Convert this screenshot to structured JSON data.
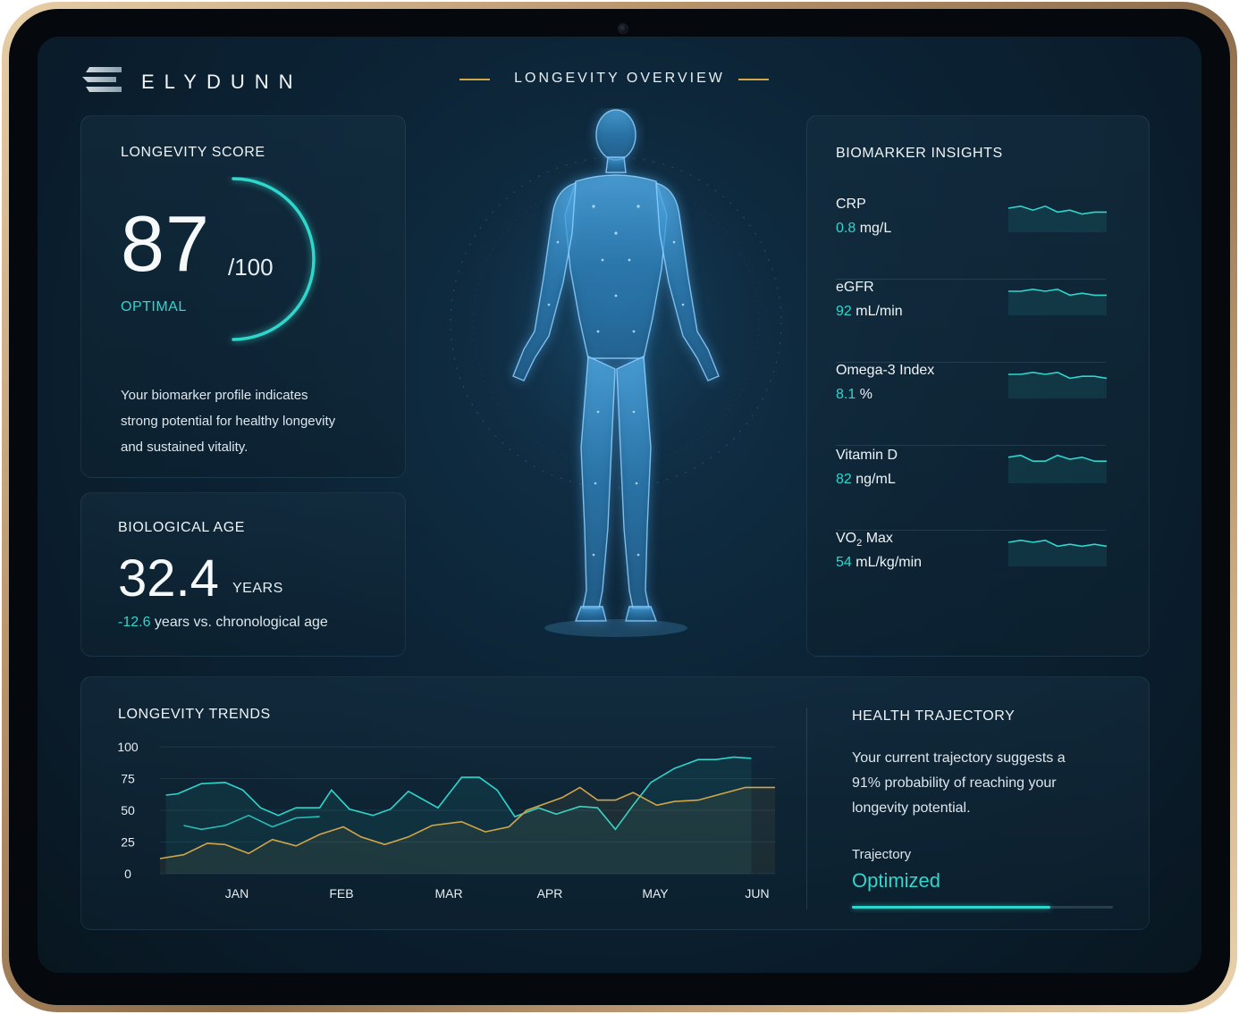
{
  "brand": {
    "name": "ELYDUNN",
    "icon": "stacked-bars-logo-icon"
  },
  "header": {
    "title": "LONGEVITY OVERVIEW"
  },
  "colors": {
    "accent": "#2fd6cc",
    "gold": "#d4a64a",
    "background": "#0c2436"
  },
  "score": {
    "label": "LONGEVITY SCORE",
    "value": "87",
    "max": "/100",
    "status": "OPTIMAL",
    "progress_fraction": 0.5,
    "description": "Your biomarker profile indicates strong potential for healthy longevity and sustained vitality."
  },
  "bio_age": {
    "label": "BIOLOGICAL AGE",
    "value": "32.4",
    "unit": "YEARS",
    "diff": "-12.6",
    "diff_text": " years vs. chronological age"
  },
  "biomarkers": {
    "title": "BIOMARKER INSIGHTS",
    "items": [
      {
        "name": "CRP",
        "name_sub": "",
        "name_suffix": "",
        "value": "0.8",
        "unit": " mg/L",
        "spark": [
          5,
          6,
          4,
          6,
          3,
          4,
          2,
          3,
          3
        ]
      },
      {
        "name": "eGFR",
        "name_sub": "",
        "name_suffix": "",
        "value": "92",
        "unit": " mL/min",
        "spark": [
          5,
          5,
          6,
          5,
          6,
          3,
          4,
          3,
          3
        ]
      },
      {
        "name": "Omega-3 Index",
        "name_sub": "",
        "name_suffix": "",
        "value": "8.1",
        "unit": " %",
        "spark": [
          5,
          5,
          6,
          5,
          6,
          3,
          4,
          4,
          3
        ]
      },
      {
        "name": "Vitamin D",
        "name_sub": "",
        "name_suffix": "",
        "value": "82",
        "unit": " ng/mL",
        "spark": [
          6,
          7,
          4,
          4,
          7,
          5,
          6,
          4,
          4
        ]
      },
      {
        "name": "VO",
        "name_sub": "2",
        "name_suffix": " Max",
        "value": "54",
        "unit": " mL/kg/min",
        "spark": [
          5,
          6,
          5,
          6,
          3,
          4,
          3,
          4,
          3
        ]
      }
    ]
  },
  "trends": {
    "label": "LONGEVITY TRENDS",
    "chart_data": {
      "type": "line",
      "categories": [
        "JAN",
        "FEB",
        "MAR",
        "APR",
        "MAY",
        "JUN"
      ],
      "ylim": [
        0,
        100
      ],
      "yticks": [
        100,
        75,
        50,
        25,
        0
      ],
      "series": [
        {
          "color": "#2fd6cc",
          "x": [
            0.05,
            0.15,
            0.35,
            0.55,
            0.7,
            0.85,
            1.0,
            1.15,
            1.35,
            1.45,
            1.6,
            1.8,
            1.95,
            2.1,
            2.35,
            2.55,
            2.7,
            2.85,
            3.0,
            3.2,
            3.35,
            3.55,
            3.7,
            3.85,
            4.0,
            4.15,
            4.35,
            4.55,
            4.7,
            4.85,
            5.0
          ],
          "y": [
            62,
            63,
            71,
            72,
            66,
            52,
            46,
            52,
            52,
            66,
            51,
            46,
            51,
            65,
            52,
            76,
            76,
            66,
            45,
            52,
            47,
            53,
            52,
            35,
            54,
            72,
            83,
            90,
            90,
            92,
            91
          ]
        },
        {
          "color": "#2fd6cc",
          "x": [
            0.2,
            0.35,
            0.55,
            0.75,
            0.95,
            1.15,
            1.35
          ],
          "y": [
            38,
            35,
            38,
            46,
            37,
            44,
            45
          ],
          "faint": true
        },
        {
          "color": "#d4a64a",
          "x": [
            0.0,
            0.2,
            0.4,
            0.55,
            0.75,
            0.95,
            1.15,
            1.35,
            1.55,
            1.7,
            1.9,
            2.1,
            2.3,
            2.55,
            2.75,
            2.95,
            3.1,
            3.25,
            3.4,
            3.55,
            3.7,
            3.85,
            4.0,
            4.2,
            4.35,
            4.55,
            4.75,
            4.95,
            5.2
          ],
          "y": [
            12,
            15,
            24,
            23,
            16,
            27,
            22,
            31,
            37,
            29,
            23,
            29,
            38,
            41,
            33,
            37,
            50,
            55,
            60,
            68,
            58,
            58,
            64,
            54,
            57,
            58,
            63,
            68,
            68
          ]
        }
      ]
    }
  },
  "trajectory": {
    "label": "HEALTH TRAJECTORY",
    "text": "Your current trajectory suggests a 91% probability of reaching your longevity potential.",
    "sub_label": "Trajectory",
    "value": "Optimized",
    "progress": 0.76
  }
}
